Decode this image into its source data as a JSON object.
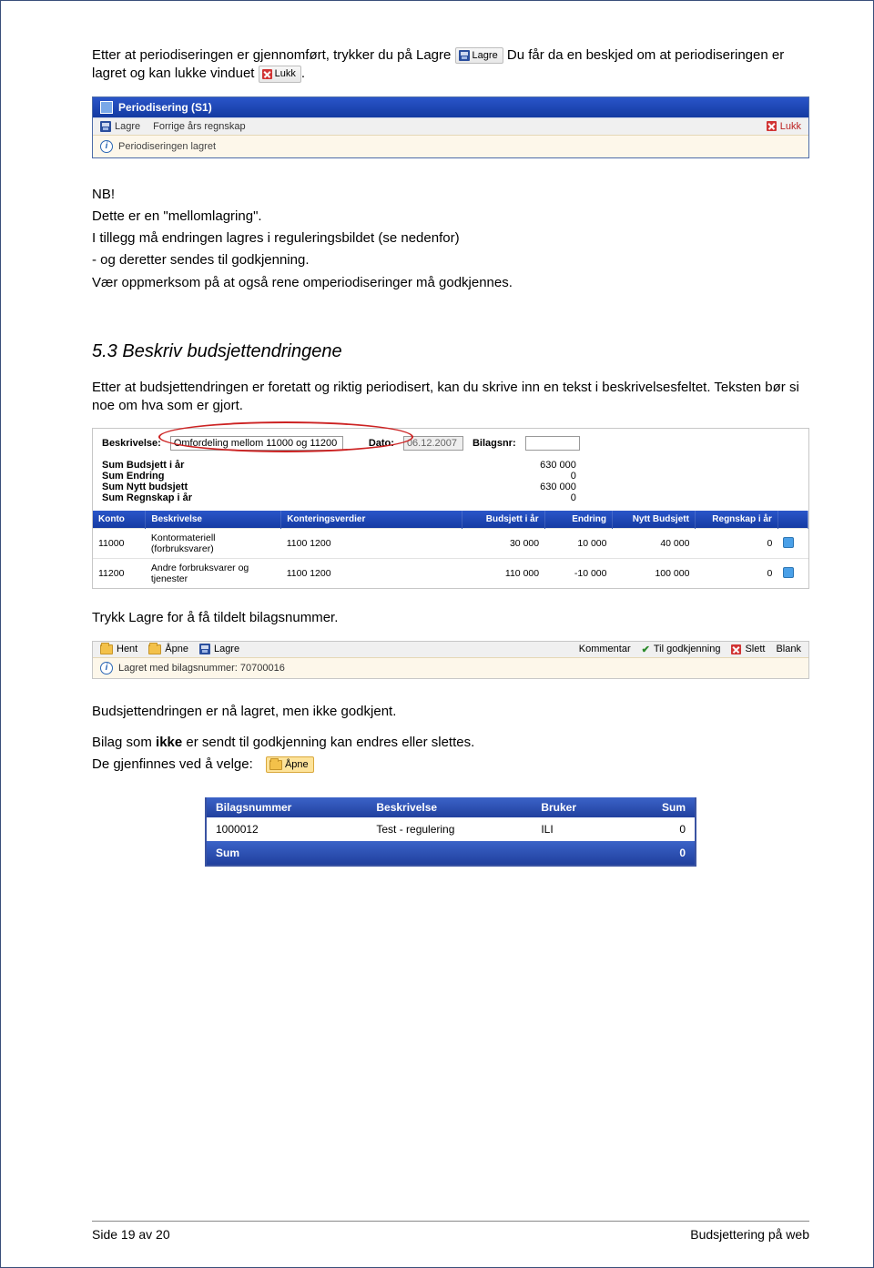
{
  "p1_a": "Etter at periodiseringen er gjennomført, trykker du på Lagre ",
  "p1_b": " Du får da en beskjed om at periodiseringen er lagret og kan lukke vinduet ",
  "btn_lagre": "Lagre",
  "btn_lukk": "Lukk",
  "window1": {
    "title": "Periodisering (S1)",
    "tool_lagre": "Lagre",
    "tool_forrige": "Forrige års regnskap",
    "tool_lukk": "Lukk",
    "status": "Periodiseringen lagret"
  },
  "nb_line": "NB!",
  "nb_text": "Dette er en \"mellomlagring\".",
  "nb_p2a": "I tillegg må endringen lagres i reguleringsbildet (se nedenfor)",
  "nb_p2b": "- og deretter sendes til godkjenning.",
  "nb_p3": "Vær oppmerksom på at også rene omperiodiseringer må godkjennes.",
  "h2": "5.3  Beskriv budsjettendringene",
  "h2_text": "Etter at budsjettendringen er foretatt og riktig periodisert, kan du skrive inn en tekst i beskrivelsesfeltet. Teksten bør si noe om hva som er gjort.",
  "budget": {
    "lbl_beskrivelse": "Beskrivelse:",
    "val_beskrivelse": "Omfordeling mellom 11000 og 11200",
    "lbl_dato": "Dato:",
    "val_dato": "06.12.2007",
    "lbl_bilag": "Bilagsnr:",
    "val_bilag": "",
    "sums": [
      {
        "k": "Sum Budsjett i år",
        "v": "630 000"
      },
      {
        "k": "Sum Endring",
        "v": "0"
      },
      {
        "k": "Sum Nytt budsjett",
        "v": "630 000"
      },
      {
        "k": "Sum Regnskap i år",
        "v": "0"
      }
    ],
    "headers": [
      "Konto",
      "Beskrivelse",
      "Konteringsverdier",
      "Budsjett i år",
      "Endring",
      "Nytt Budsjett",
      "Regnskap i år",
      ""
    ],
    "rows": [
      {
        "konto": "11000",
        "beskr": "Kontormateriell (forbruksvarer)",
        "kont": "1100 1200",
        "b": "30 000",
        "e": "10 000",
        "n": "40 000",
        "r": "0"
      },
      {
        "konto": "11200",
        "beskr": "Andre forbruksvarer og tjenester",
        "kont": "1100 1200",
        "b": "110 000",
        "e": "-10 000",
        "n": "100 000",
        "r": "0"
      }
    ]
  },
  "p_trykk": "Trykk Lagre for å få tildelt bilagsnummer.",
  "toolbar2": {
    "hent": "Hent",
    "apne": "Åpne",
    "lagre": "Lagre",
    "kommentar": "Kommentar",
    "godkj": "Til godkjenning",
    "slett": "Slett",
    "blank": "Blank",
    "status": "Lagret med bilagsnummer: 70700016"
  },
  "p_lagret": "Budsjettendringen er nå lagret, men ikke godkjent.",
  "p_bilag_a": "Bilag som ",
  "p_bilag_bold": "ikke",
  "p_bilag_b": " er sendt til godkjenning kan endres eller slettes.",
  "p_gjenfinnes": "De gjenfinnes ved å velge:",
  "btn_apne": "Åpne",
  "bilag_table": {
    "headers": [
      "Bilagsnummer",
      "Beskrivelse",
      "Bruker",
      "Sum"
    ],
    "row": {
      "nr": "1000012",
      "beskr": "Test - regulering",
      "bruker": "ILI",
      "sum": "0"
    },
    "foot_label": "Sum",
    "foot_val": "0"
  },
  "footer_left": "Side 19 av 20",
  "footer_right": "Budsjettering på web"
}
